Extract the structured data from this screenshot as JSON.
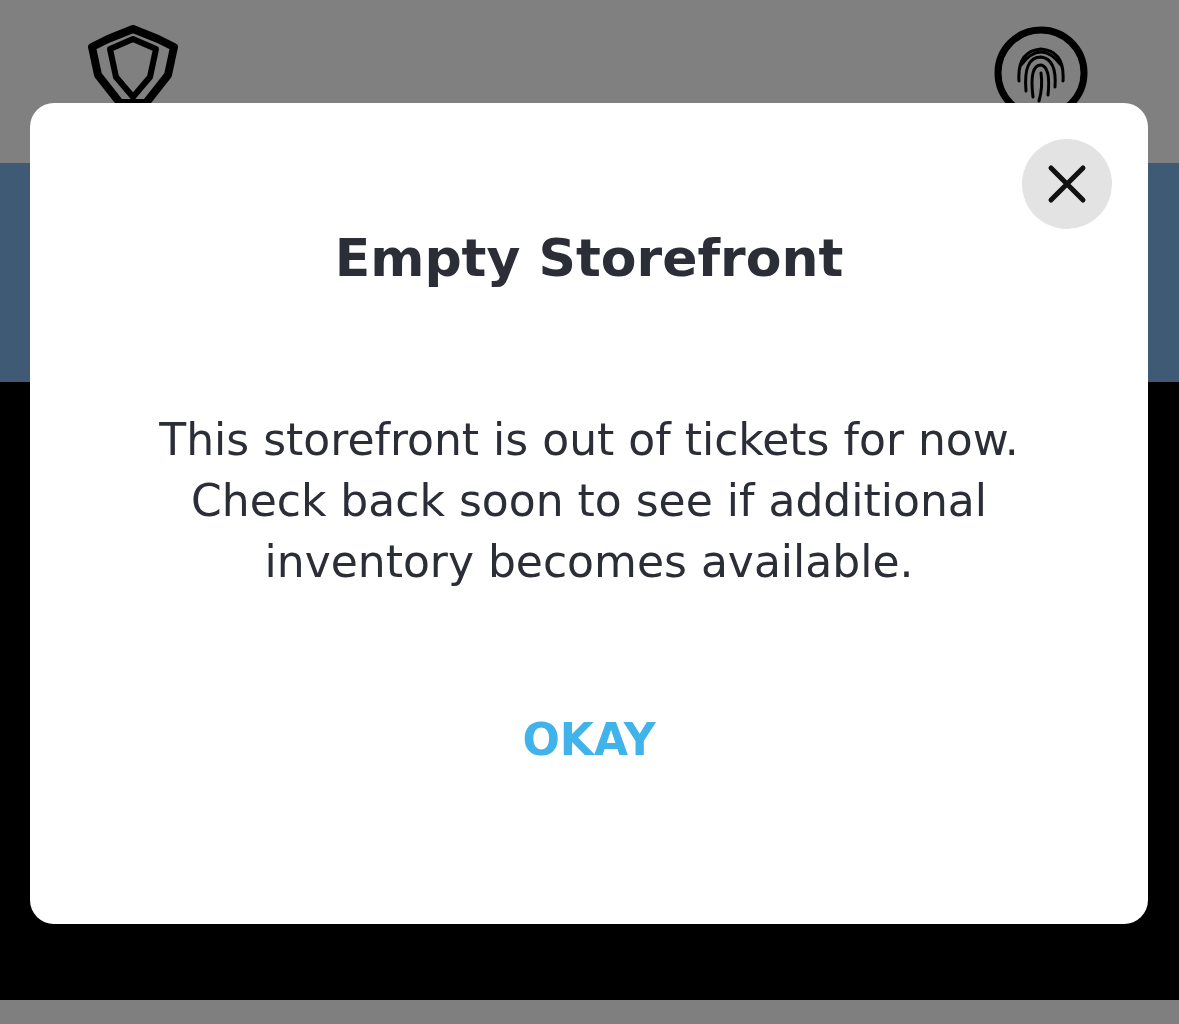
{
  "dialog": {
    "title": "Empty Storefront",
    "message": "This storefront is out of tickets for now. Check back soon to see if additional inventory becomes available.",
    "button": "OKAY"
  }
}
